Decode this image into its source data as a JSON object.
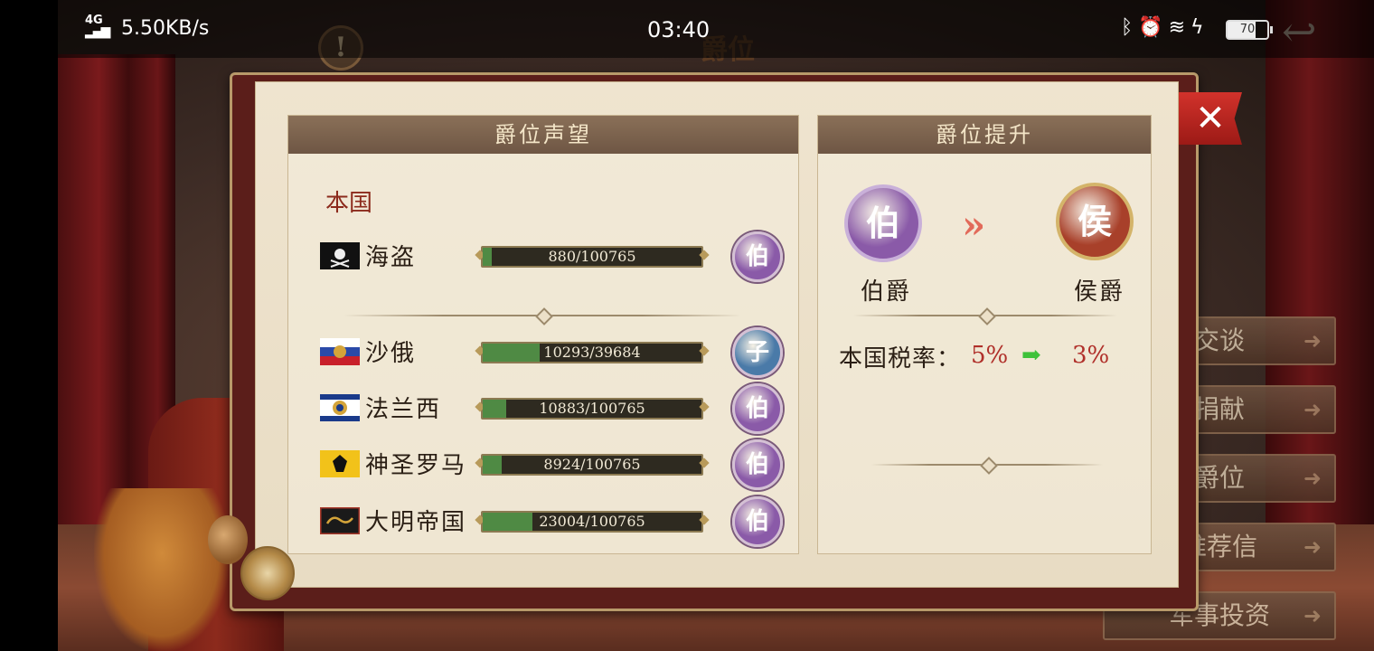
{
  "status_bar": {
    "signal": "4G",
    "net_speed": "5.50KB/s",
    "time": "03:40",
    "battery": "70",
    "icons": [
      "bluetooth-icon",
      "alarm-icon",
      "wifi-icon",
      "charging-icon"
    ]
  },
  "background": {
    "title": "爵位"
  },
  "right_menu": [
    "交谈",
    "捐献",
    "爵位",
    "推荐信",
    "军事投资"
  ],
  "left_panel": {
    "header": "爵位声望",
    "section_label": "本国",
    "rows": [
      {
        "nation": "海盗",
        "progress_text": "880/100765",
        "current": 880,
        "max": 100765,
        "rank": "伯"
      },
      {
        "nation": "沙俄",
        "progress_text": "10293/39684",
        "current": 10293,
        "max": 39684,
        "rank": "子"
      },
      {
        "nation": "法兰西",
        "progress_text": "10883/100765",
        "current": 10883,
        "max": 100765,
        "rank": "伯"
      },
      {
        "nation": "神圣罗马",
        "progress_text": "8924/100765",
        "current": 8924,
        "max": 100765,
        "rank": "伯"
      },
      {
        "nation": "大明帝国",
        "progress_text": "23004/100765",
        "current": 23004,
        "max": 100765,
        "rank": "伯"
      }
    ]
  },
  "right_panel": {
    "header": "爵位提升",
    "current_rank_badge": "伯",
    "current_rank_name": "伯爵",
    "next_rank_badge": "侯",
    "next_rank_name": "侯爵",
    "tax_label": "本国税率：",
    "tax_current": "5%",
    "tax_next": "3%"
  },
  "close_label": "✕",
  "colors": {
    "count_badge": "#8a5aa8",
    "viscount_badge": "#4a7aa8",
    "marquis_badge": "#a8402a",
    "progress_fill": "#4f8a44",
    "tax_value": "#b0302a"
  }
}
